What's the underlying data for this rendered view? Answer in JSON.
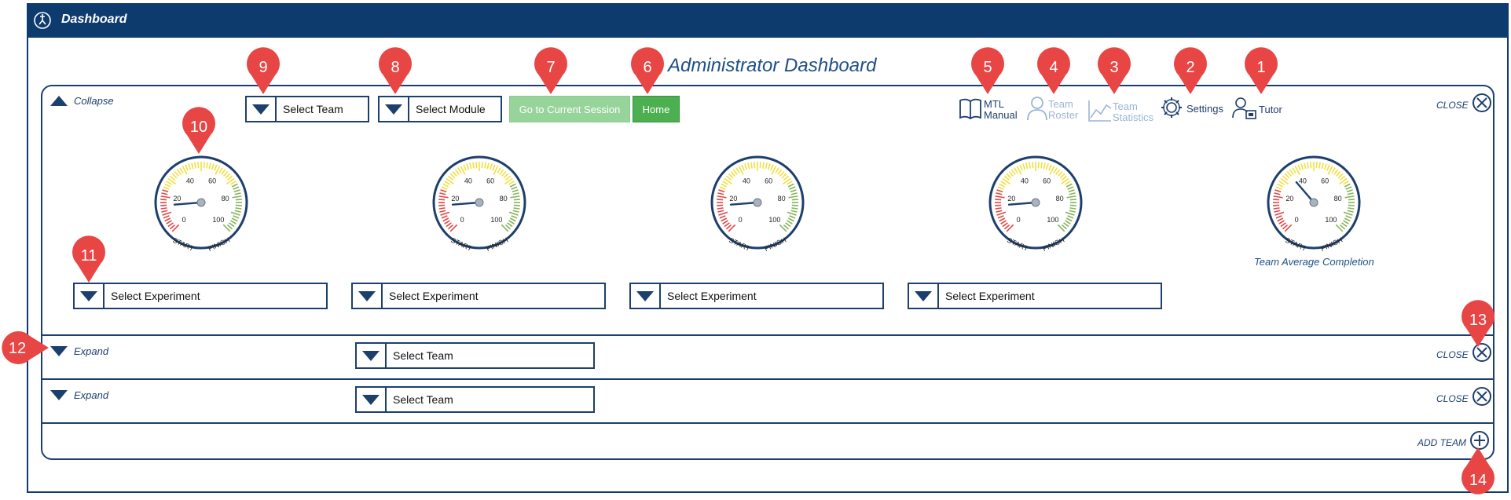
{
  "window": {
    "title": "Dashboard",
    "icon": "compass-icon"
  },
  "page_title": "Administrator Dashboard",
  "colors": {
    "brand_navy": "#0e3b6e",
    "accent_blue": "#1f4f86",
    "green": "#4caf50",
    "marker_red": "#e84545"
  },
  "team1": {
    "collapse_label": "Collapse",
    "select_team": "Select Team",
    "select_module": "Select Module",
    "go_current_session": "Go to Current Session",
    "home": "Home",
    "tools": {
      "mtl_manual_1": "MTL",
      "mtl_manual_2": "Manual",
      "team_roster_1": "Team",
      "team_roster_2": "Roster",
      "team_stats_1": "Team",
      "team_stats_2": "Statistics",
      "settings": "Settings",
      "tutor": "Tutor"
    },
    "close_label": "CLOSE",
    "gauges": [
      {
        "progress_percent": 15
      },
      {
        "progress_percent": 15
      },
      {
        "progress_percent": 15
      },
      {
        "progress_percent": 15
      },
      {
        "progress_percent": 35
      }
    ],
    "gauge_ticks": [
      "0",
      "20",
      "40",
      "60",
      "80",
      "100"
    ],
    "gauge_start": "START",
    "gauge_finish": "FINISH",
    "team_average_label": "Team Average Completion",
    "experiments": [
      "Select Experiment",
      "Select Experiment",
      "Select Experiment",
      "Select Experiment"
    ]
  },
  "team2": {
    "expand_label": "Expand",
    "select_team": "Select Team",
    "close_label": "CLOSE"
  },
  "team3": {
    "expand_label": "Expand",
    "select_team": "Select Team",
    "close_label": "CLOSE"
  },
  "add_team_label": "ADD TEAM",
  "markers": [
    "1",
    "2",
    "3",
    "4",
    "5",
    "6",
    "7",
    "8",
    "9",
    "10",
    "11",
    "12",
    "13",
    "14"
  ]
}
